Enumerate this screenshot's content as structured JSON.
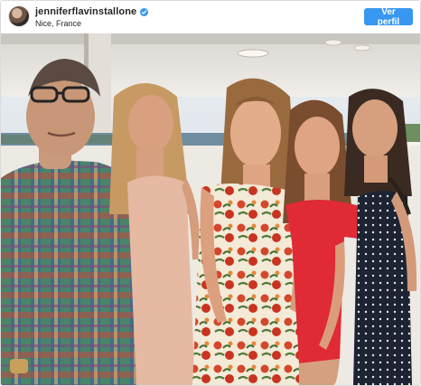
{
  "post": {
    "username": "jenniferflavinstallone",
    "location": "Nice, France",
    "view_profile_label": "Ver perfil"
  },
  "icons": {
    "verified": "verified-badge-icon",
    "avatar": "profile-avatar"
  },
  "colors": {
    "button_blue": "#3897f0",
    "text": "#262626",
    "border": "#dbdbdb"
  },
  "photo": {
    "subject_count": 5
  }
}
